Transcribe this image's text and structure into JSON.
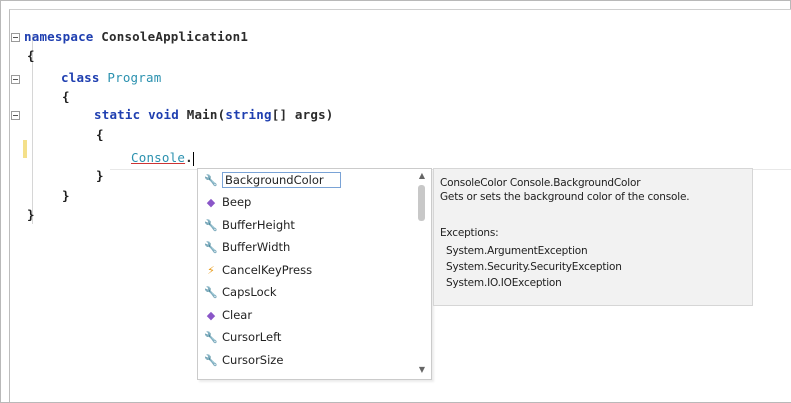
{
  "code": {
    "line1": {
      "keyword": "namespace",
      "name": "ConsoleApplication1"
    },
    "line2": "{",
    "line3": {
      "keyword": "class",
      "name": "Program"
    },
    "line4": "{",
    "line5": {
      "keywords": "static void",
      "name": "Main(",
      "param_type": "string",
      "param_rest": "[] args)"
    },
    "line6": "{",
    "line7": {
      "typed": "Console",
      "dot": "."
    },
    "line8": "}",
    "line9": "}",
    "line10": "}"
  },
  "completion_list": {
    "items": [
      {
        "label": "BackgroundColor",
        "icon": "property-wrench-icon",
        "selected": true
      },
      {
        "label": "Beep",
        "icon": "method-icon"
      },
      {
        "label": "BufferHeight",
        "icon": "property-wrench-icon"
      },
      {
        "label": "BufferWidth",
        "icon": "property-wrench-icon"
      },
      {
        "label": "CancelKeyPress",
        "icon": "event-lightning-icon"
      },
      {
        "label": "CapsLock",
        "icon": "property-wrench-icon"
      },
      {
        "label": "Clear",
        "icon": "method-icon"
      },
      {
        "label": "CursorLeft",
        "icon": "property-wrench-icon"
      },
      {
        "label": "CursorSize",
        "icon": "property-wrench-icon"
      }
    ]
  },
  "tooltip": {
    "signature": "ConsoleColor Console.BackgroundColor",
    "description": "Gets or sets the background color of the console.",
    "exceptions_header": "Exceptions:",
    "exceptions": [
      "System.ArgumentException",
      "System.Security.SecurityException",
      "System.IO.IOException"
    ]
  }
}
